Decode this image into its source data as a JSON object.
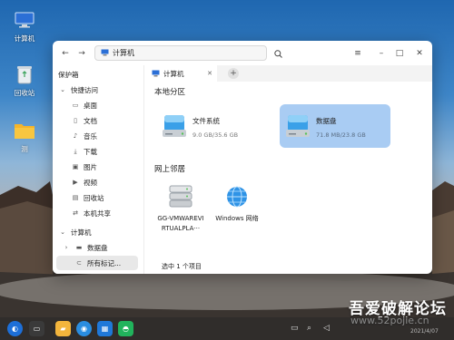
{
  "desktop": {
    "icons": [
      {
        "label": "计算机",
        "icon": "computer-icon"
      },
      {
        "label": "回收站",
        "icon": "trash-icon"
      },
      {
        "label": "测",
        "icon": "folder-icon"
      }
    ]
  },
  "window": {
    "path": "计算机",
    "tab_label": "计算机",
    "sidebar": [
      {
        "label": "保护箱",
        "icon": ""
      },
      {
        "label": "快捷访问",
        "icon": "chevron-down-icon"
      },
      {
        "label": "桌面",
        "icon": "desktop-icon"
      },
      {
        "label": "文档",
        "icon": "document-icon"
      },
      {
        "label": "音乐",
        "icon": "music-icon"
      },
      {
        "label": "下载",
        "icon": "download-icon"
      },
      {
        "label": "图片",
        "icon": "image-icon"
      },
      {
        "label": "视频",
        "icon": "video-icon"
      },
      {
        "label": "回收站",
        "icon": "trash-icon"
      },
      {
        "label": "本机共享",
        "icon": "share-icon"
      },
      {
        "label": "计算机",
        "icon": "chevron-down-icon"
      },
      {
        "label": "数据盘",
        "icon": "chevron-right-icon"
      },
      {
        "label": "所有标记...",
        "icon": "tag-icon"
      }
    ],
    "local_section": "本地分区",
    "drives": [
      {
        "name": "文件系统",
        "size": "9.0 GB/35.6 GB",
        "used": 0.25,
        "selected": false
      },
      {
        "name": "数据盘",
        "size": "71.8 MB/23.8 GB",
        "used": 0.003,
        "selected": true
      }
    ],
    "network_section": "网上邻居",
    "network_items": [
      {
        "label_line1": "GG-VMWAREVI",
        "label_line2": "RTUALPLA···"
      },
      {
        "label_line1": "Windows 网络",
        "label_line2": ""
      }
    ],
    "status": "选中 1 个项目"
  },
  "taskbar": {
    "date": "2021/4/07"
  },
  "watermark": {
    "line1": "吾爱破解论坛",
    "line2": "www.52pojie.cn"
  },
  "colors": {
    "accent": "#1e7be6",
    "selection": "#a9ccf3"
  }
}
